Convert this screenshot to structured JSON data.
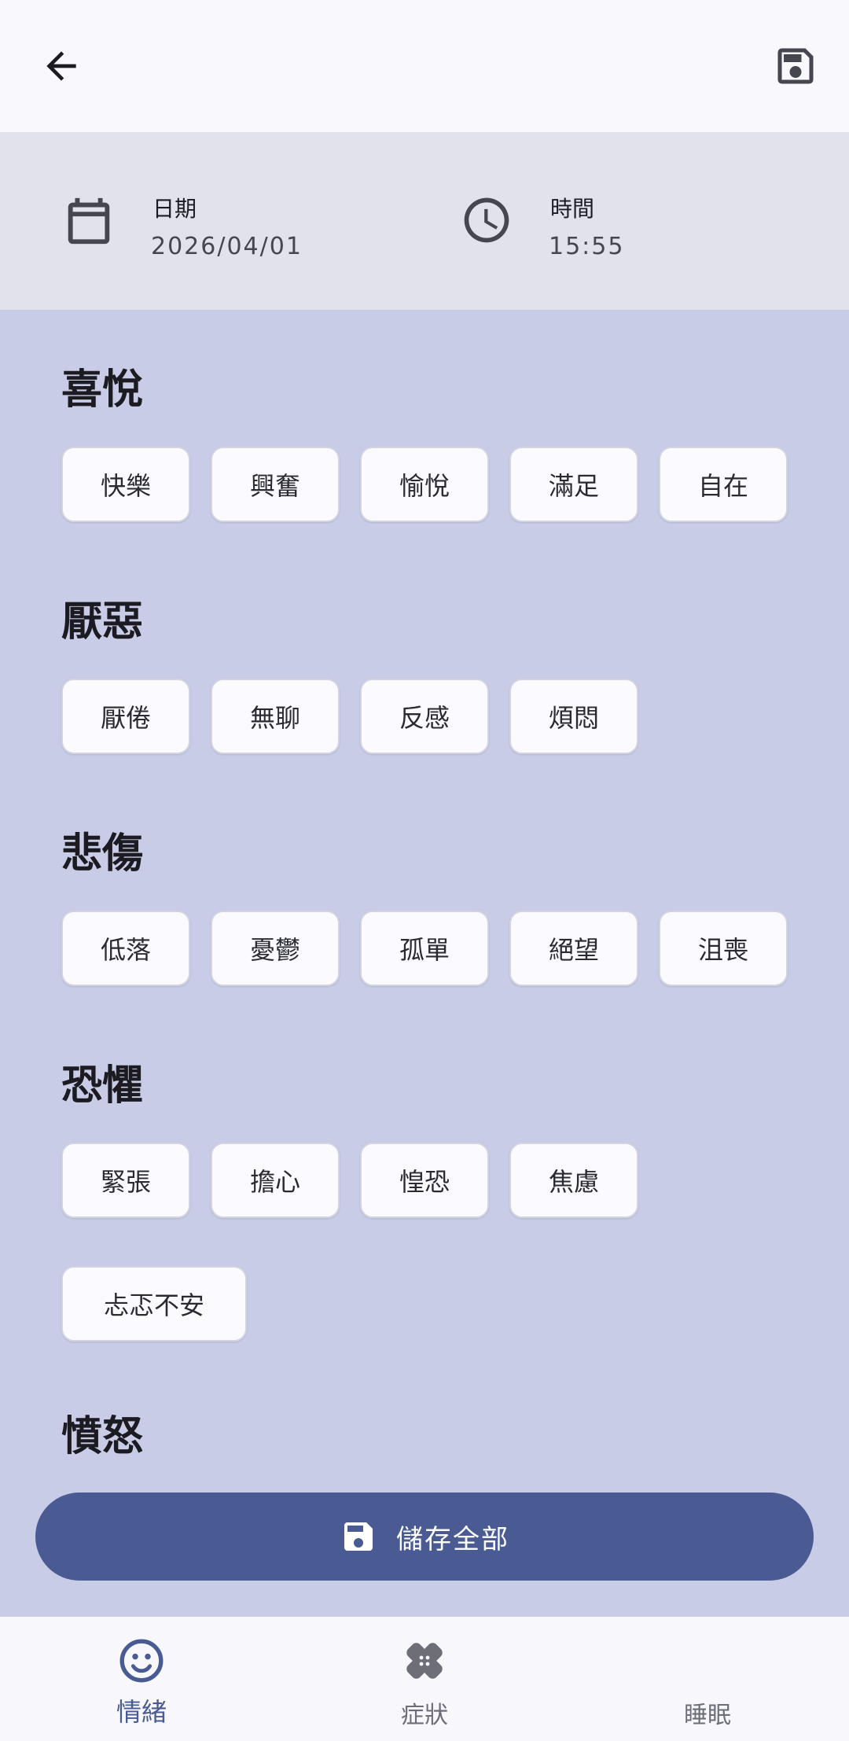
{
  "topbar": {
    "back_icon": "arrow-back-icon",
    "save_icon": "floppy-save-icon"
  },
  "datetime": {
    "date_label": "日期",
    "date_value": "2026/04/01",
    "time_label": "時間",
    "time_value": "15:55"
  },
  "categories": [
    {
      "title": "喜悅",
      "chips": [
        "快樂",
        "興奮",
        "愉悅",
        "滿足",
        "自在"
      ]
    },
    {
      "title": "厭惡",
      "chips": [
        "厭倦",
        "無聊",
        "反感",
        "煩悶"
      ]
    },
    {
      "title": "悲傷",
      "chips": [
        "低落",
        "憂鬱",
        "孤單",
        "絕望",
        "沮喪"
      ]
    },
    {
      "title": "恐懼",
      "chips": [
        "緊張",
        "擔心",
        "惶恐",
        "焦慮",
        "忐忑不安"
      ]
    },
    {
      "title": "憤怒",
      "chips": []
    }
  ],
  "save_all": {
    "label": "儲存全部"
  },
  "nav": [
    {
      "label": "情緒",
      "icon": "smiley-face-icon",
      "active": true
    },
    {
      "label": "症狀",
      "icon": "bandage-icon",
      "active": false
    },
    {
      "label": "睡眠",
      "icon": "moon-icon",
      "active": false
    }
  ],
  "colors": {
    "primary": "#495b92",
    "background": "#c8cce6",
    "surface": "#f8f8fd",
    "datebar": "#e1e2ec"
  }
}
